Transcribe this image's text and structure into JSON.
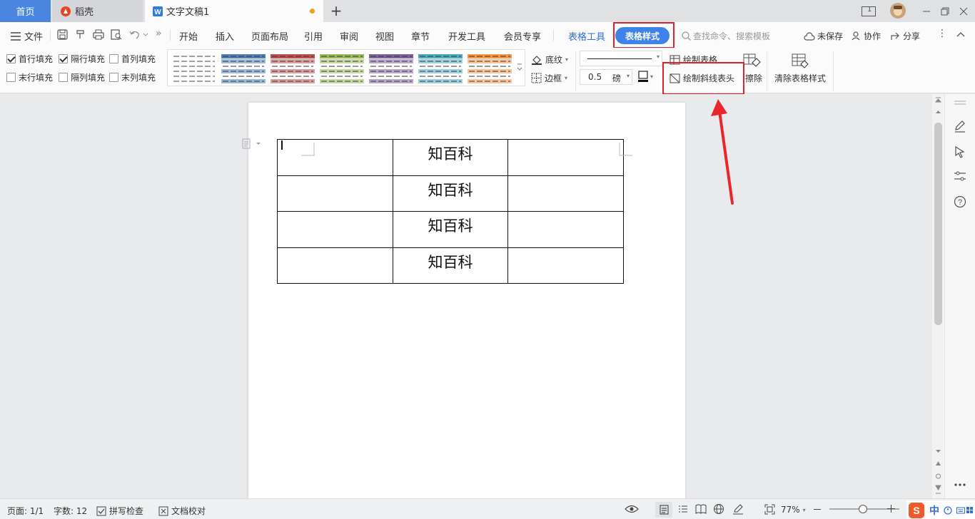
{
  "tabs": {
    "home": "首页",
    "daoke": "稻壳",
    "doc": "文字文稿1",
    "new_tab": "+"
  },
  "window": {
    "view_badge": "1"
  },
  "menu": {
    "file": "文件",
    "more": "»",
    "items": [
      "开始",
      "插入",
      "页面布局",
      "引用",
      "审阅",
      "视图",
      "章节",
      "开发工具",
      "会员专享"
    ],
    "table_tools": "表格工具",
    "table_style": "表格样式",
    "search_placeholder": "查找命令、搜索模板",
    "unsaved": "未保存",
    "collab": "协作",
    "share": "分享",
    "kebab": "⋮"
  },
  "ribbon": {
    "checkboxes": [
      {
        "label": "首行填充",
        "checked": true
      },
      {
        "label": "隔行填充",
        "checked": true
      },
      {
        "label": "首列填充",
        "checked": false
      },
      {
        "label": "末行填充",
        "checked": false
      },
      {
        "label": "隔列填充",
        "checked": false
      },
      {
        "label": "末列填充",
        "checked": false
      }
    ],
    "style_colors": [
      "#666666",
      "#4f81bd",
      "#c0504d",
      "#9bbb59",
      "#8064a2",
      "#4bacc6",
      "#f79646"
    ],
    "shading": "底纹",
    "border": "边框",
    "line_width": "0.5",
    "line_unit": "磅",
    "draw_table": "绘制表格",
    "erase": "擦除",
    "draw_diagonal_header": "绘制斜线表头",
    "clear_style": "清除表格样式"
  },
  "document": {
    "rows": [
      [
        "",
        "知百科",
        ""
      ],
      [
        "",
        "知百科",
        ""
      ],
      [
        "",
        "知百科",
        ""
      ],
      [
        "",
        "知百科",
        ""
      ]
    ]
  },
  "status": {
    "page": "页面: 1/1",
    "words": "字数: 12",
    "spell_check": "拼写检查",
    "doc_check": "文档校对",
    "zoom": "77%",
    "zoom_level": 0.77,
    "ime": "中"
  },
  "colors": {
    "accent": "#3f83e8",
    "highlight": "#e0232a"
  }
}
